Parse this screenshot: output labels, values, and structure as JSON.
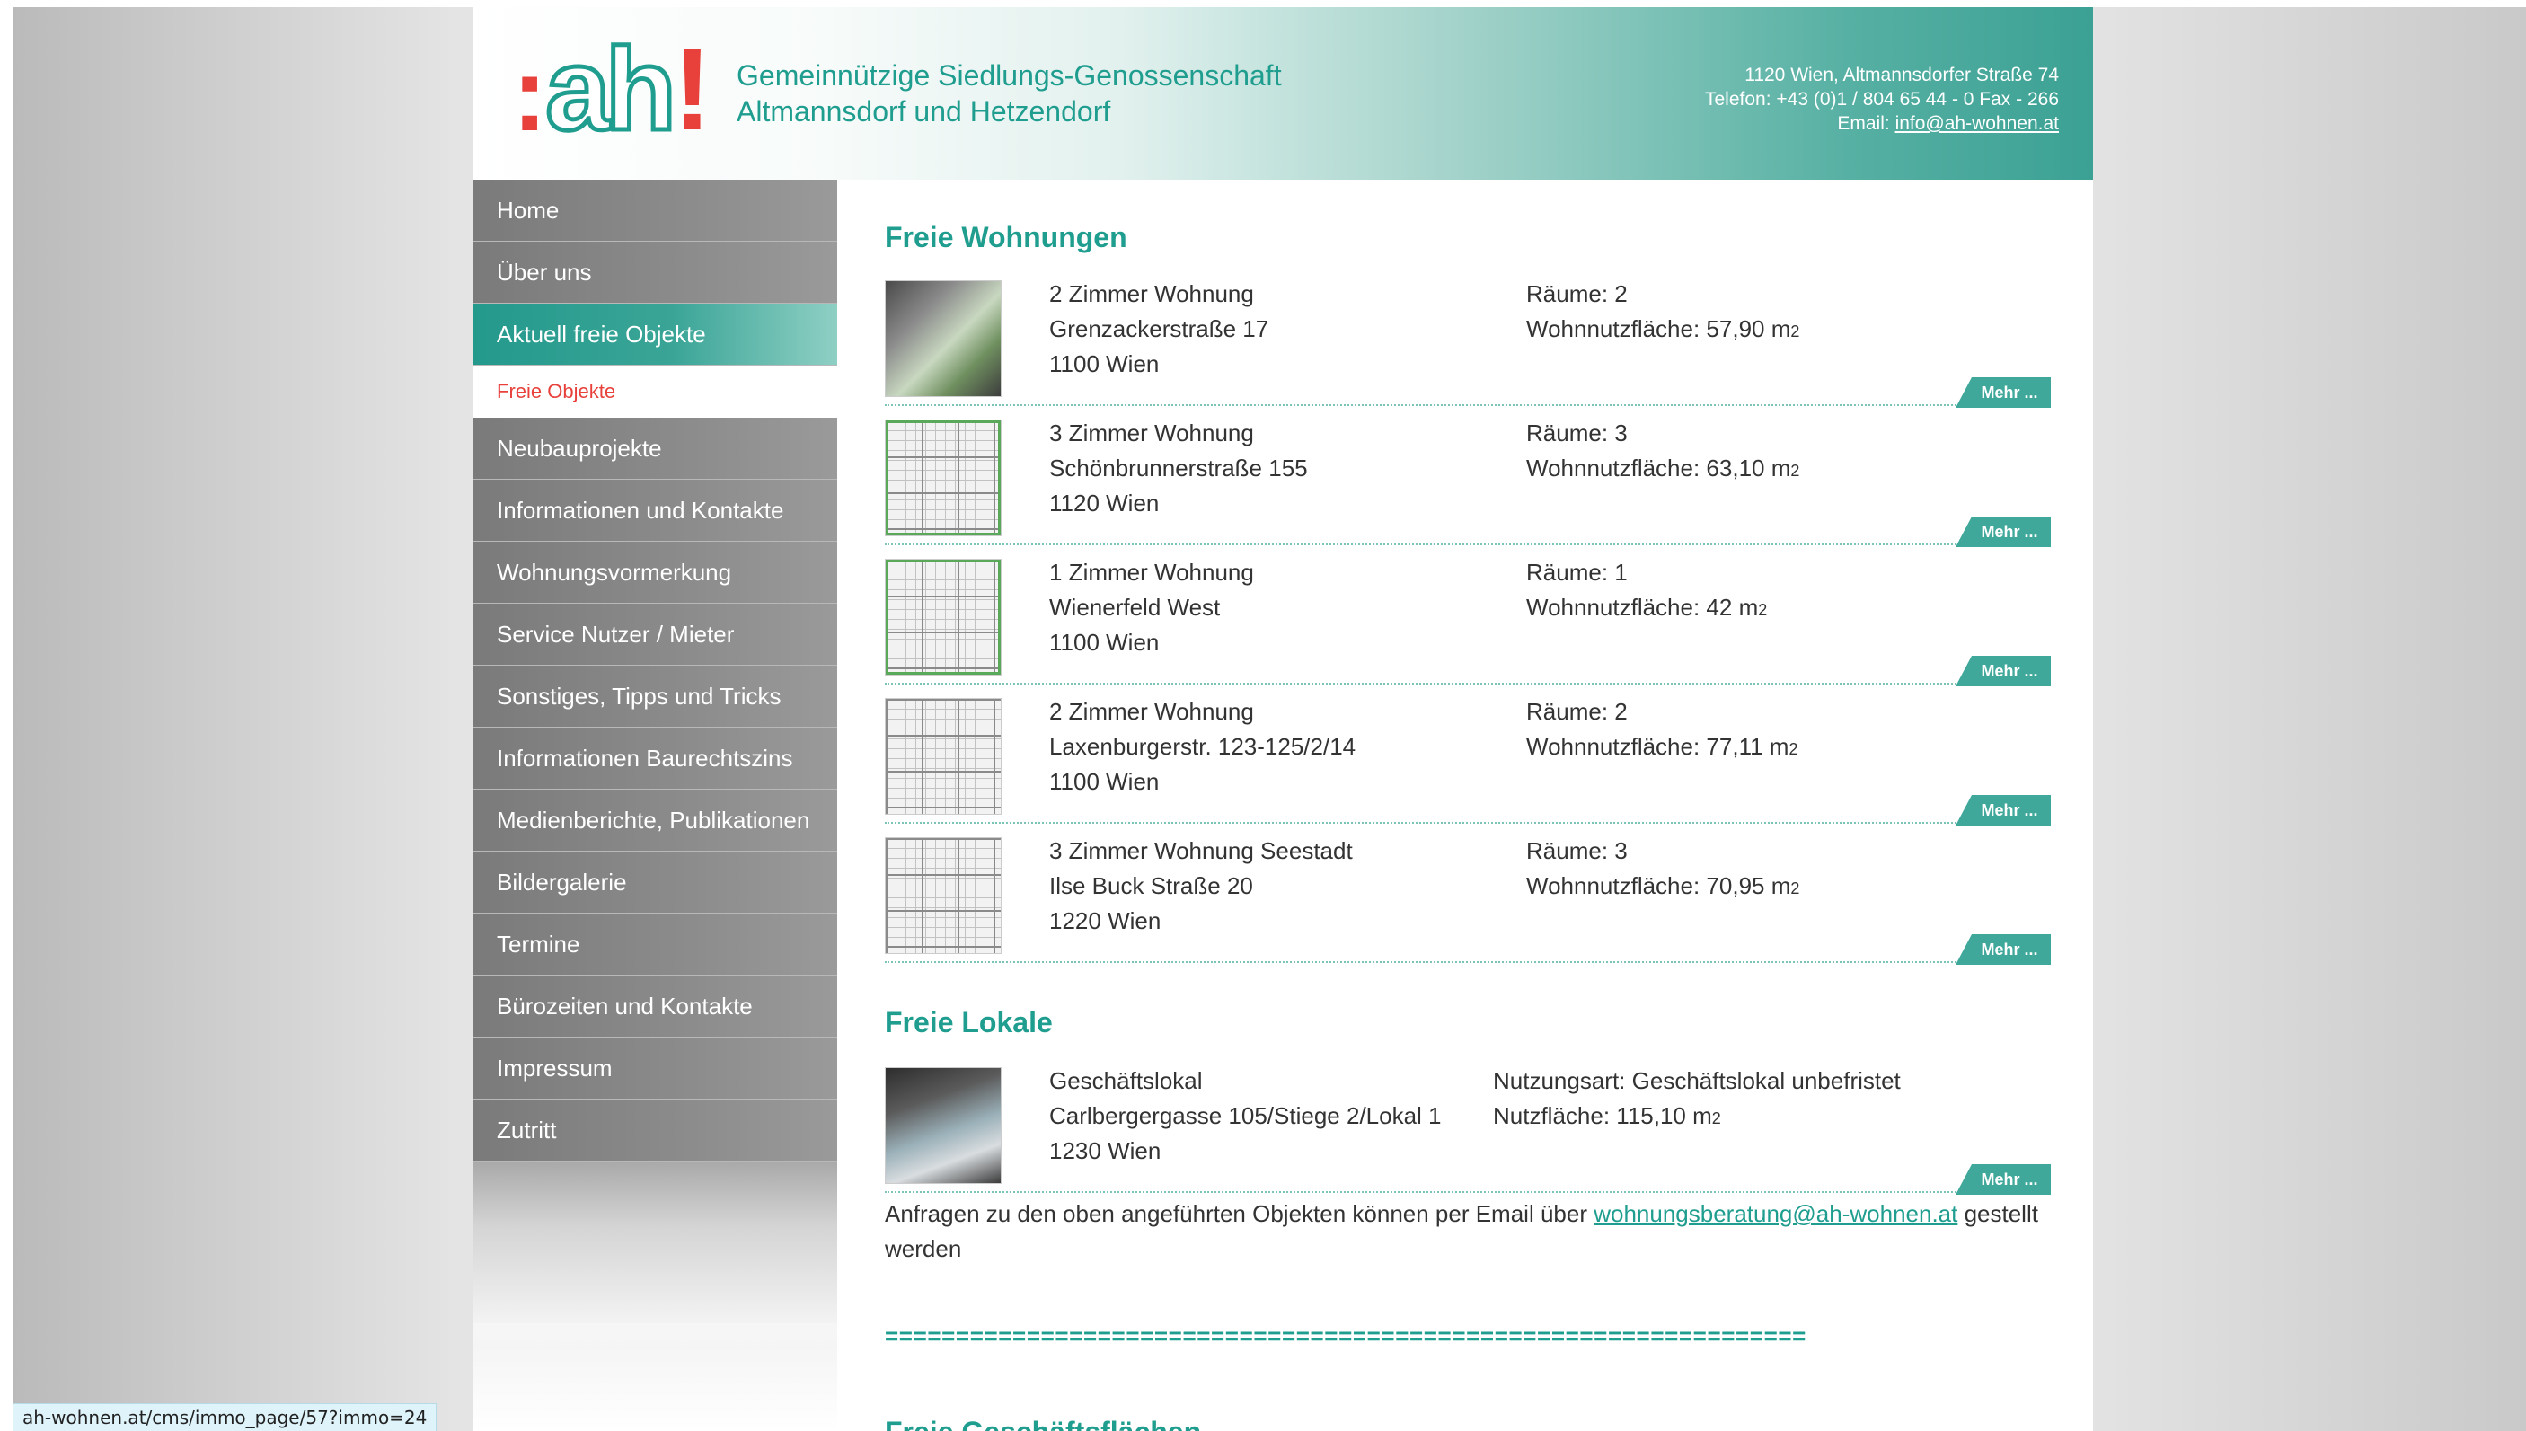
{
  "header": {
    "logo_text": ":ah!",
    "org_line1": "Gemeinnützige Siedlungs-Genossenschaft",
    "org_line2": "Altmannsdorf und Hetzendorf",
    "address": "1120 Wien, Altmannsdorfer Straße 74",
    "phone": "Telefon: +43 (0)1 / 804 65 44 - 0  Fax - 266",
    "email_label": "Email:",
    "email": "info@ah-wohnen.at"
  },
  "sidebar": {
    "items": [
      {
        "label": "Home"
      },
      {
        "label": "Über uns"
      },
      {
        "label": "Aktuell freie Objekte"
      },
      {
        "label": "Freie Objekte"
      },
      {
        "label": "Neubauprojekte"
      },
      {
        "label": "Informationen und Kontakte"
      },
      {
        "label": "Wohnungsvormerkung"
      },
      {
        "label": "Service Nutzer / Mieter"
      },
      {
        "label": "Sonstiges, Tipps und Tricks"
      },
      {
        "label": "Informationen Baurechtszins"
      },
      {
        "label": "Medienberichte, Publikationen"
      },
      {
        "label": "Bildergalerie"
      },
      {
        "label": "Termine"
      },
      {
        "label": "Bürozeiten und Kontakte"
      },
      {
        "label": "Impressum"
      },
      {
        "label": "Zutritt"
      }
    ]
  },
  "main": {
    "section1_title": "Freie Wohnungen",
    "apartments": [
      {
        "type": "2 Zimmer Wohnung",
        "street": "Grenzackerstraße 17",
        "city": "1100 Wien",
        "rooms": "Räume: 2",
        "area": "Wohnnutzfläche: 57,90 m",
        "area_unit": "2",
        "more": "Mehr ..."
      },
      {
        "type": "3 Zimmer Wohnung",
        "street": "Schönbrunnerstraße 155",
        "city": "1120 Wien",
        "rooms": "Räume: 3",
        "area": "Wohnnutzfläche: 63,10 m",
        "area_unit": "2",
        "more": "Mehr ..."
      },
      {
        "type": "1 Zimmer Wohnung",
        "street": "Wienerfeld West",
        "city": "1100 Wien",
        "rooms": "Räume: 1",
        "area": "Wohnnutzfläche: 42 m",
        "area_unit": "2",
        "more": "Mehr ..."
      },
      {
        "type": "2 Zimmer Wohnung",
        "street": "Laxenburgerstr. 123-125/2/14",
        "city": "1100 Wien",
        "rooms": "Räume: 2",
        "area": "Wohnnutzfläche: 77,11 m",
        "area_unit": "2",
        "more": "Mehr ..."
      },
      {
        "type": "3 Zimmer Wohnung Seestadt",
        "street": "Ilse Buck Straße 20",
        "city": "1220 Wien",
        "rooms": "Räume: 3",
        "area": "Wohnnutzfläche: 70,95 m",
        "area_unit": "2",
        "more": "Mehr ..."
      }
    ],
    "section2_title": "Freie Lokale",
    "shop": {
      "type": "Geschäftslokal",
      "street": "Carlbergergasse 105/Stiege 2/Lokal 1",
      "city": "1230 Wien",
      "usage": "Nutzungsart: Geschäftslokal unbefristet",
      "area": "Nutzfläche: 115,10 m",
      "area_unit": "2",
      "more": "Mehr ..."
    },
    "note_before": "Anfragen zu den oben angeführten Objekten können per Email über ",
    "note_email": "wohnungsberatung@ah-wohnen.at",
    "note_after": " gestellt werden",
    "separator": "=================================================================",
    "section3_title": "Freie Geschäftsflächen"
  },
  "statusbar": {
    "url": "ah-wohnen.at/cms/immo_page/57?immo=24"
  },
  "colors": {
    "accent": "#1f9d8f",
    "logo_red": "#e8413c",
    "nav_gray": "#8c8c8c"
  }
}
